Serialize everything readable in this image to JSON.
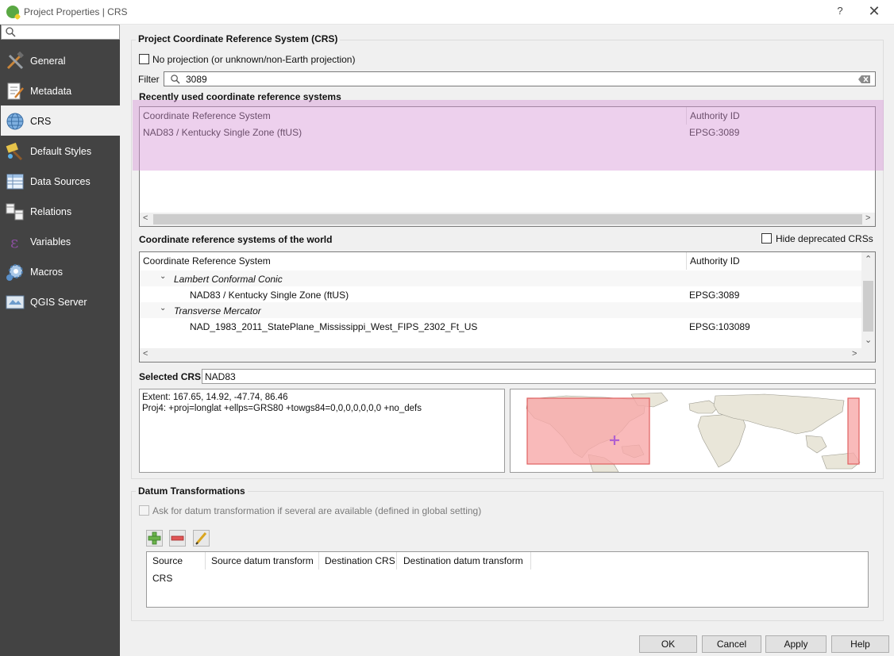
{
  "window": {
    "title": "Project Properties | CRS",
    "help": "?",
    "close": "✕"
  },
  "sidebar": {
    "search_placeholder": "",
    "items": [
      {
        "label": "General",
        "icon": "tools-icon"
      },
      {
        "label": "Metadata",
        "icon": "metadata-icon"
      },
      {
        "label": "CRS",
        "icon": "globe-icon",
        "selected": true
      },
      {
        "label": "Default Styles",
        "icon": "paint-brush-icon"
      },
      {
        "label": "Data Sources",
        "icon": "table-icon"
      },
      {
        "label": "Relations",
        "icon": "relations-icon"
      },
      {
        "label": "Variables",
        "icon": "epsilon-icon"
      },
      {
        "label": "Macros",
        "icon": "macro-gear-icon"
      },
      {
        "label": "QGIS Server",
        "icon": "server-map-icon"
      }
    ]
  },
  "crs": {
    "group_title": "Project Coordinate Reference System (CRS)",
    "no_projection_label": "No projection (or unknown/non-Earth projection)",
    "filter_label": "Filter",
    "filter_value": "3089",
    "recent_title": "Recently used coordinate reference systems",
    "recent_headers": [
      "Coordinate Reference System",
      "Authority ID"
    ],
    "recent_rows": [
      {
        "name": "NAD83 / Kentucky Single Zone (ftUS)",
        "id": "EPSG:3089"
      }
    ],
    "world_title": "Coordinate reference systems of the world",
    "hide_deprecated_label": "Hide deprecated CRSs",
    "world_headers": [
      "Coordinate Reference System",
      "Authority ID"
    ],
    "world_tree": [
      {
        "group": "Lambert Conformal Conic",
        "items": [
          {
            "name": "NAD83 / Kentucky Single Zone (ftUS)",
            "id": "EPSG:3089"
          }
        ]
      },
      {
        "group": "Transverse Mercator",
        "items": [
          {
            "name": "NAD_1983_2011_StatePlane_Mississippi_West_FIPS_2302_Ft_US",
            "id": "EPSG:103089"
          }
        ]
      }
    ],
    "selected_label": "Selected CRS",
    "selected_value": "NAD83",
    "extent_text": "Extent: 167.65, 14.92, -47.74, 86.46",
    "proj4_text": "Proj4: +proj=longlat +ellps=GRS80 +towgs84=0,0,0,0,0,0,0 +no_defs"
  },
  "datum": {
    "group_title": "Datum Transformations",
    "ask_label": "Ask for datum transformation if several are available (defined in global setting)",
    "headers": [
      "Source CRS",
      "Source datum transform",
      "Destination CRS",
      "Destination datum transform"
    ]
  },
  "buttons": {
    "ok": "OK",
    "cancel": "Cancel",
    "apply": "Apply",
    "help": "Help"
  },
  "colors": {
    "highlight": "#e9c9e9",
    "extent_fill": "#f7a9a9",
    "sidebar_bg": "#434343"
  }
}
